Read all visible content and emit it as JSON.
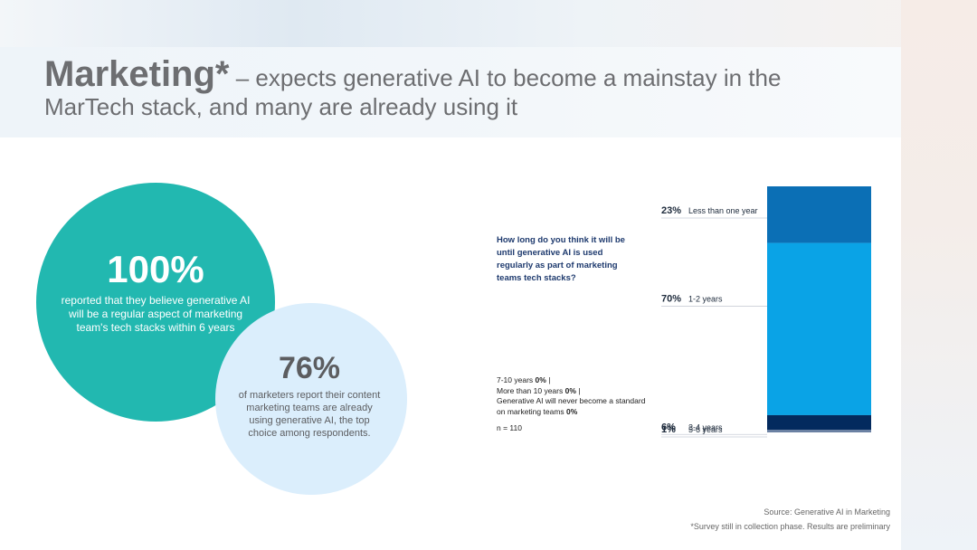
{
  "title": {
    "bold": "Marketing*",
    "dash": " – ",
    "rest": "expects generative AI to become a mainstay in the MarTech stack, and many are already using it"
  },
  "stat_main": {
    "value": "100%",
    "description": "reported that they believe generative AI will be a regular aspect of marketing team's tech stacks within 6 years"
  },
  "stat_secondary": {
    "value": "76%",
    "description": "of marketers report their content marketing teams are already using generative AI, the top choice among respondents."
  },
  "question": "How long do you think it will be until generative AI is used regularly as part of marketing teams tech stacks?",
  "zero_notes": [
    {
      "label": "7-10 years",
      "value": "0%",
      "sep": " |"
    },
    {
      "label": "More than 10 years",
      "value": "0%",
      "sep": " |"
    },
    {
      "label": "Generative AI will never become a standard on marketing teams",
      "value": "0%",
      "sep": ""
    }
  ],
  "sample": "n = 110",
  "chart_data": {
    "type": "bar",
    "stacked": true,
    "categories": [
      "Less than one year",
      "1-2 years",
      "3-4 years",
      "5-6 years"
    ],
    "values": [
      23,
      70,
      6,
      1
    ],
    "labels": [
      "23%",
      "70%",
      "6%",
      "1%"
    ],
    "colors": [
      "#0b6fb5",
      "#0aa3e6",
      "#032a5e",
      "#6b81a3"
    ]
  },
  "source": "Source: Generative AI in Marketing",
  "footnote": "*Survey still in collection phase. Results are preliminary"
}
